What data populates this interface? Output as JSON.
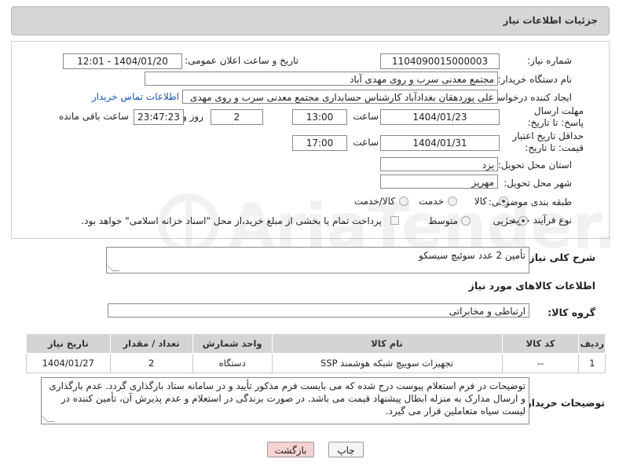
{
  "header": {
    "title": "جزئیات اطلاعات نیاز"
  },
  "need_number": {
    "label": "شماره نیاز:",
    "value": "1104090015000003"
  },
  "announce": {
    "label": "تاریخ و ساعت اعلان عمومی:",
    "value": "1404/01/20 - 12:01"
  },
  "buyer_org": {
    "label": "نام دستگاه خریدار:",
    "value": "مجتمع معدنی سرب و روی مهدی آباد"
  },
  "creator": {
    "label": "ایجاد کننده درخواست:",
    "value": "علی پوردهقان بغدادآباد کارشناس حسابداری مجتمع معدنی سرب و روی مهدی",
    "contact_link": "اطلاعات تماس خریدار"
  },
  "reply_deadline": {
    "label": "مهلت ارسال پاسخ: تا تاریخ:",
    "date": "1404/01/23",
    "time_label": "ساعت",
    "time": "13:00",
    "days": "2",
    "days_label": "روز و",
    "remaining": "23:47:23",
    "remaining_label": "ساعت باقی مانده"
  },
  "price_validity": {
    "label": "حداقل تاریخ اعتبار قیمت: تا تاریخ:",
    "date": "1404/01/31",
    "time_label": "ساعت",
    "time": "17:00"
  },
  "province": {
    "label": "استان محل تحویل:",
    "value": "یزد"
  },
  "city": {
    "label": "شهر محل تحویل:",
    "value": "مهریز"
  },
  "category": {
    "label": "طبقه بندی موضوعی:",
    "options": [
      "کالا",
      "خدمت",
      "کالا/خدمت"
    ],
    "selected": "کالا"
  },
  "purchase_type": {
    "label": "نوع فرآیند خرید :",
    "options": [
      "جزیی",
      "متوسط"
    ],
    "selected": "جزیی",
    "note": "پرداخت تمام یا بخشی از مبلغ خرید،از محل \"اسناد خزانه اسلامی\" خواهد بود."
  },
  "description": {
    "label": "شرح کلی نیاز:",
    "value": "تأمین 2 عدد سوئیچ سیسکو"
  },
  "goods_section": {
    "title": "اطلاعات کالاهای مورد نیاز"
  },
  "goods_group": {
    "label": "گروه کالا:",
    "value": "ارتباطی و مخابراتی"
  },
  "table": {
    "headers": [
      "ردیف",
      "کد کالا",
      "نام کالا",
      "واحد شمارش",
      "تعداد / مقدار",
      "تاریخ نیاز"
    ],
    "rows": [
      [
        "1",
        "--",
        "تجهیزات سوییچ شبکه هوشمند SSP",
        "دستگاه",
        "2",
        "1404/01/27"
      ]
    ]
  },
  "buyer_notes": {
    "label": "توضیحات خریدار:",
    "value": "توضیحات در فرم استعلام پیوست درج شده که می بایست فرم مذکور تأیید و در سامانه ستاد بارگذاری گردد. عدم بارگذاری و ارسال مدارک به منزله ابطال پیشنهاد قیمت می باشد. در صورت برندگی در استعلام و عدم پذیرش آن، تأمین کننده در لیست سیاه متعاملین قرار می گیرد."
  },
  "buttons": {
    "print": "چاپ",
    "back": "بازگشت"
  },
  "watermark": {
    "text": "AriaTender.neT"
  },
  "colors": {
    "link": "#1a56b0",
    "back_button": "#f6d3d3",
    "header_bg": "#d6d6d6"
  }
}
